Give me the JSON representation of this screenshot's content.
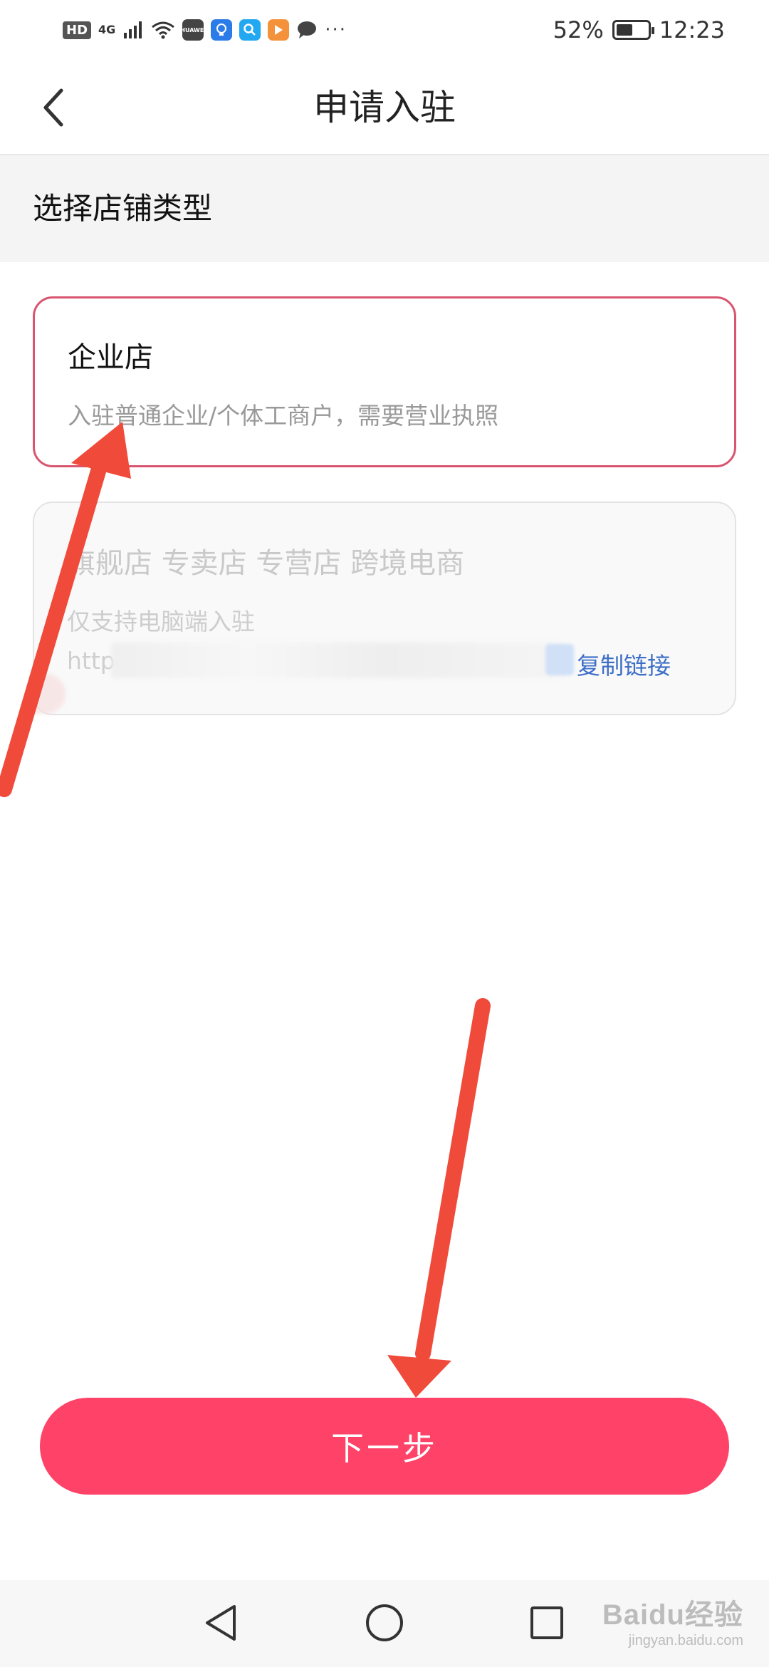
{
  "status_bar": {
    "hd_badge": "HD",
    "network": "4G",
    "huawei_label": "HUAWEI",
    "more": "···",
    "battery_percent": "52%",
    "battery_level": 0.52,
    "time": "12:23"
  },
  "header": {
    "title": "申请入驻",
    "back_icon": "chevron-left-icon"
  },
  "section": {
    "title": "选择店铺类型"
  },
  "cards": [
    {
      "title": "企业店",
      "desc": "入驻普通企业/个体工商户，需要营业执照",
      "selected": true
    },
    {
      "title": "旗舰店 专卖店 专营店 跨境电商",
      "desc": "仅支持电脑端入驻",
      "link_prefix": "http",
      "copy_label": "复制链接",
      "disabled": true
    }
  ],
  "next_button": {
    "label": "下一步"
  },
  "nav": {
    "back": "triangle-back-icon",
    "home": "circle-home-icon",
    "recents": "square-recents-icon"
  },
  "watermark": {
    "main": "Baidu经验",
    "sub": "jingyan.baidu.com"
  },
  "colors": {
    "accent": "#ff4368",
    "selected_border": "#d9556f",
    "link": "#3d6fc7",
    "annotation_arrow": "#f04a3a"
  }
}
